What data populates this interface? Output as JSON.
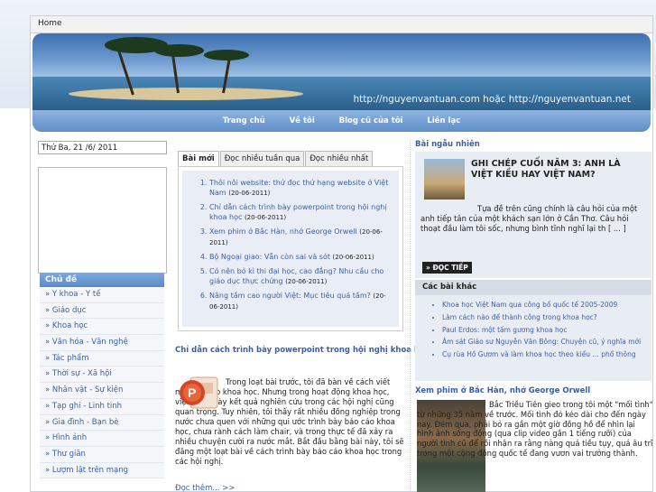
{
  "home_label": "Home",
  "banner": {
    "url_text": "http://nguyenvantuan.com hoặc http://nguyenvantuan.net"
  },
  "nav": [
    "Trang chủ",
    "Về tôi",
    "Blog cũ của tôi",
    "Liên lạc"
  ],
  "date": "Thứ Ba, 21 /6/ 2011",
  "chude": {
    "title": "Chủ đề",
    "items": [
      "» Y khoa - Y tế",
      "» Giáo dục",
      "» Khoa học",
      "» Văn hóa - Văn nghệ",
      "» Tác phẩm",
      "» Thời sự - Xã hội",
      "» Nhân vật - Sự kiện",
      "» Tạp ghi - Linh tinh",
      "» Gia đình - Bạn bè",
      "» Hình ảnh",
      "» Thư giãn",
      "» Lượm lặt trên mạng"
    ]
  },
  "tabs": [
    "Bài mới",
    "Đọc nhiều tuần qua",
    "Đọc nhiều nhất"
  ],
  "new_posts": [
    {
      "title": "Thôi nôi website: thử đọc thứ hạng website ở Việt Nam",
      "date": "(20-06-2011)"
    },
    {
      "title": "Chỉ dẫn cách trình bày powerpoint trong hội nghị khoa học",
      "date": "(20-06-2011)"
    },
    {
      "title": "Xem phim ở Bắc Hàn, nhớ George Orwell",
      "date": "(20-06-2011)"
    },
    {
      "title": "Bộ Ngoại giao: Vẫn còn sai và sót",
      "date": "(20-06-2011)"
    },
    {
      "title": "Có nên bỏ kì thi đại học, cao đẳng? Nhu cầu cho giáo dục thực chứng",
      "date": "(20-06-2011)"
    },
    {
      "title": "Nâng tầm cao người Việt: Mục tiêu quá tầm?",
      "date": "(20-06-2011)"
    }
  ],
  "post": {
    "title": "Chỉ dẫn cách trình bày powerpoint trong hội nghị khoa học",
    "text": "Trong loạt bài trước, tôi đã bàn về cách viết một bài báo khoa học. Nhưng trong hoạt động khoa học, việc trình bày kết quả nghiên cứu trong các hội nghị cũng quan trọng. Tuy nhiên, tôi thấy rất nhiều đồng nghiệp trong nước chưa quen với những qui ước trình bày báo cáo khoa học, chưa rành cách làm chair, và trong thực tế đã xảy ra nhiều chuyện cười ra nước mắt. Bắt đầu bằng bài này, tôi sẽ đăng một loạt bài về cách trình bày báo cáo khoa học trong các hội nghị.",
    "more": "Đọc thêm...   >>"
  },
  "random": {
    "head": "Bài ngẫu nhiên",
    "title": "GHI CHÉP CUỐI NĂM 3: ANH LÀ VIỆT KIỀU HAY VIỆT NAM?",
    "text": "Tựa đề trên cũng chính là câu hỏi của một anh tiếp tân của một khách sạn lớn ở Cần Thơ. Câu hỏi thoạt đầu làm tôi sốc, nhưng bình tĩnh nghĩ lại th [ ... ]",
    "button": "» ĐỌC TIẾP"
  },
  "other": {
    "head": "Các bài khác",
    "items": [
      "Khoa học Việt Nam qua công bố quốc tế 2005-2009",
      "Làm cách nào để thành công trong khoa học?",
      "Paul Erdos: một tấm gương khoa học",
      "Âm sát Giáo sư Nguyễn Văn Bông: Chuyện cũ, ý nghĩa mới",
      "Cụ rùa Hồ Gươm và làm khoa học theo kiểu … phổ thông"
    ]
  },
  "xem": {
    "title": "Xem phim ở Bắc Hàn, nhớ George Orwell",
    "text": "Bắc Triều Tiên gieo trong tôi một \"mối tình\" từ những 35 năm về trước. Mối tình đó kéo dài cho đến ngày nay. Đêm qua, phải bỏ ra gần một giờ đồng hồ để nhìn lại hình ảnh sống động (qua clip video gần 1 tiếng rưỡi) của người tình cũ để rồi nhận ra rằng nàng quá tiều tụy, quá âu trĩ trong một cộng đồng quốc tế đang vươn vai trưởng thành."
  }
}
